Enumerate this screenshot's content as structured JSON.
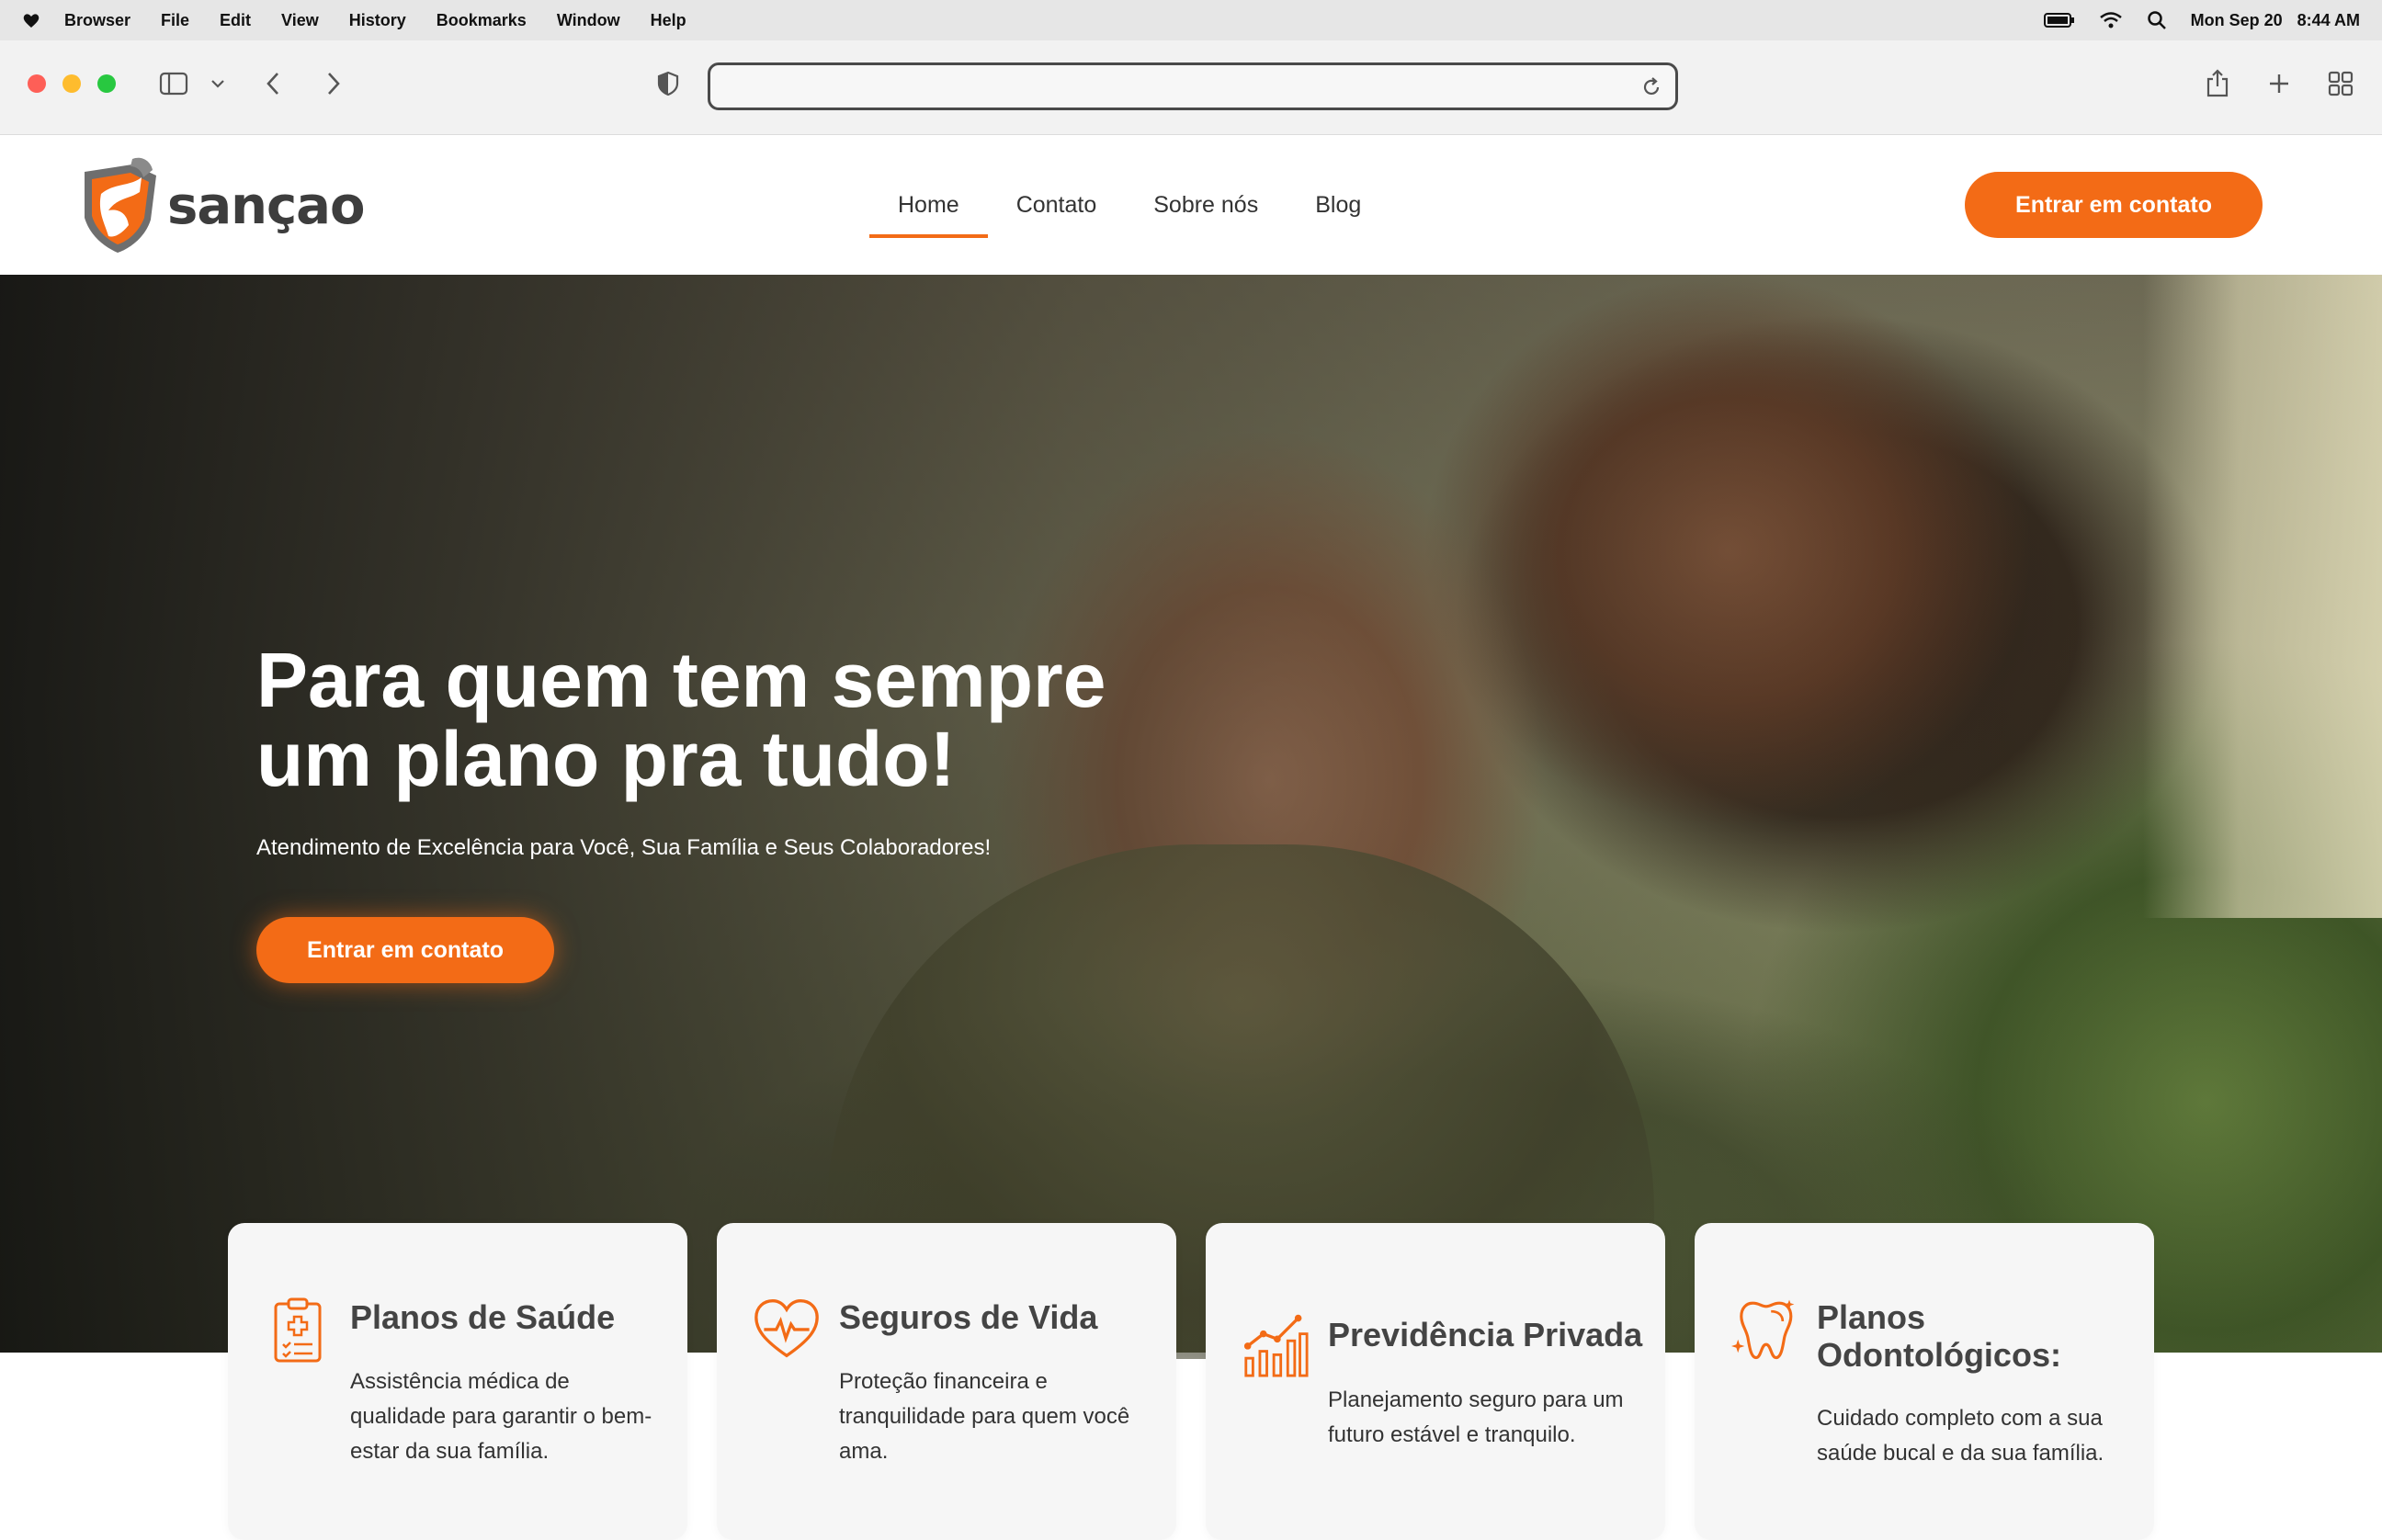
{
  "menubar": {
    "app": "Browser",
    "items": [
      "File",
      "Edit",
      "View",
      "History",
      "Bookmarks",
      "Window",
      "Help"
    ],
    "date": "Mon Sep 20",
    "time": "8:44 AM"
  },
  "browser": {
    "url": "",
    "icons": [
      "sidebar-icon",
      "chevron-down-icon",
      "back-icon",
      "forward-icon",
      "shield-icon",
      "reload-icon",
      "share-icon",
      "plus-icon",
      "tabs-grid-icon"
    ]
  },
  "site": {
    "logo_text": "sançao",
    "brand_color": "#f36b16",
    "nav": [
      {
        "label": "Home",
        "active": true
      },
      {
        "label": "Contato",
        "active": false
      },
      {
        "label": "Sobre nós",
        "active": false
      },
      {
        "label": "Blog",
        "active": false
      }
    ],
    "header_cta": "Entrar em contato"
  },
  "hero": {
    "title_line1": "Para quem tem sempre",
    "title_line2": "um plano pra tudo!",
    "subtitle": "Atendimento de Excelência para Você, Sua Família e Seus Colaboradores!",
    "cta": "Entrar em contato"
  },
  "cards": [
    {
      "title": "Planos de Saúde",
      "text": "Assistência médica de qualidade para garantir o bem-estar da sua família.",
      "icon": "clipboard-medical-icon"
    },
    {
      "title": "Seguros de Vida",
      "text": "Proteção financeira e tranquilidade para quem você ama.",
      "icon": "heart-pulse-icon"
    },
    {
      "title": "Previdência Privada",
      "text": "Planejamento seguro para um futuro estável e tranquilo.",
      "icon": "growth-chart-icon"
    },
    {
      "title": "Planos Odontológicos:",
      "text": "Cuidado completo com a sua saúde bucal e da sua família.",
      "icon": "tooth-icon"
    }
  ]
}
